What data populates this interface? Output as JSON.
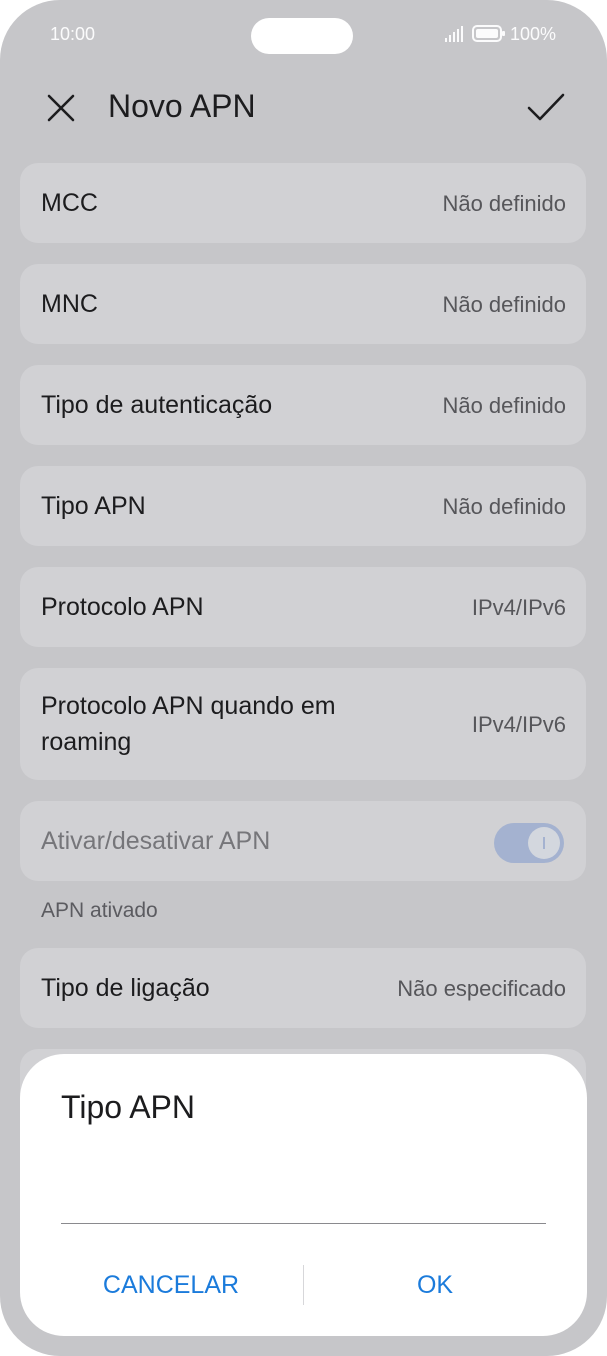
{
  "status_bar": {
    "time": "10:00",
    "battery": "100%"
  },
  "header": {
    "title": "Novo APN"
  },
  "settings": [
    {
      "label": "MCC",
      "value": "Não definido"
    },
    {
      "label": "MNC",
      "value": "Não definido"
    },
    {
      "label": "Tipo de autenticação",
      "value": "Não definido"
    },
    {
      "label": "Tipo APN",
      "value": "Não definido"
    },
    {
      "label": "Protocolo APN",
      "value": "IPv4/IPv6"
    },
    {
      "label_line1": "Protocolo APN quando em",
      "label_line2": "roaming",
      "value": "IPv4/IPv6"
    }
  ],
  "apn_toggle": {
    "label": "Ativar/desativar APN",
    "state": "on",
    "caption": "APN ativado"
  },
  "connection_type": {
    "label": "Tipo de ligação",
    "value": "Não especificado"
  },
  "dialog": {
    "title": "Tipo APN",
    "input_value": "",
    "cancel_label": "CANCELAR",
    "ok_label": "OK"
  },
  "colors": {
    "accent": "#1b7bdb",
    "background": "#c6c6c9",
    "card": "#d1d1d4",
    "toggle": "#a4b2d0"
  }
}
